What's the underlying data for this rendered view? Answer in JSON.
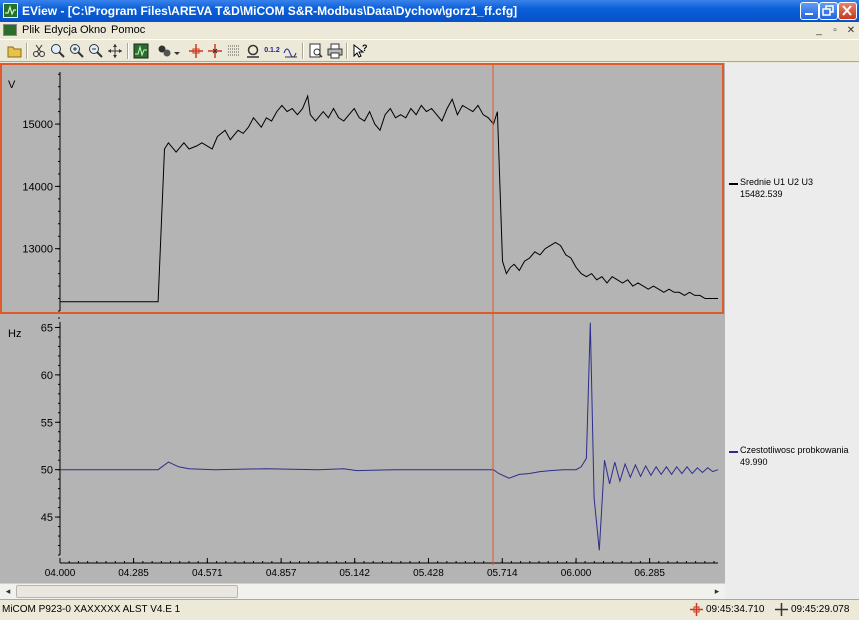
{
  "window": {
    "title": "EView - [C:\\Program Files\\AREVA T&D\\MiCOM S&R-Modbus\\Data\\Dychow\\gorz1_ff.cfg]"
  },
  "menu": [
    "Plik",
    "Edycja",
    "Okno",
    "Pomoc"
  ],
  "mdi_buttons": [
    "_",
    "▫",
    "✕"
  ],
  "toolbar_icons": [
    "open-folder-icon",
    "cut-icon",
    "zoom-icon",
    "zoom-in-icon",
    "zoom-out-icon",
    "zoom-fit-icon",
    "move-icon",
    "chart-icon",
    "color-icon",
    "dropdown-icon",
    "cursor1-icon",
    "cursor2-icon",
    "grid-icon",
    "omega-icon",
    "values-icon",
    "wave-icon",
    "print-preview-icon",
    "print-icon",
    "help-icon"
  ],
  "values_button_text": "0.1.2",
  "top_chart": {
    "unit_label": "V",
    "y_ticks": [
      "15000",
      "14000",
      "13000"
    ],
    "ylim": [
      12000,
      15900
    ],
    "legend": {
      "name": "Srednie U1 U2 U3",
      "value": "15482.539",
      "color": "#000000"
    },
    "frame_color": "#e05a2a"
  },
  "bottom_chart": {
    "unit_label": "Hz",
    "y_ticks": [
      "65",
      "60",
      "55",
      "50",
      "45"
    ],
    "ylim": [
      41,
      66
    ],
    "legend": {
      "name": "Czestotliwosc probkowania",
      "value": "49.990",
      "color": "#2d2d8c"
    }
  },
  "x_ticks": [
    "04.000",
    "04.285",
    "04.571",
    "04.857",
    "05.142",
    "05.428",
    "05.714",
    "06.000",
    "06.285"
  ],
  "cursor_color": "#e05a2a",
  "chart_data": [
    {
      "type": "line",
      "ylabel": "V",
      "x_range": [
        4.0,
        6.55
      ],
      "ylim": [
        12000,
        15900
      ],
      "series": [
        {
          "name": "Srednie U1 U2 U3",
          "color": "#000000",
          "x": [
            4.0,
            4.2,
            4.38,
            4.405,
            4.42,
            4.45,
            4.48,
            4.5,
            4.53,
            4.55,
            4.57,
            4.59,
            4.61,
            4.64,
            4.66,
            4.69,
            4.71,
            4.73,
            4.75,
            4.78,
            4.8,
            4.82,
            4.84,
            4.86,
            4.88,
            4.9,
            4.92,
            4.94,
            4.96,
            4.97,
            4.99,
            5.02,
            5.04,
            5.06,
            5.08,
            5.1,
            5.12,
            5.14,
            5.16,
            5.18,
            5.2,
            5.22,
            5.24,
            5.26,
            5.28,
            5.3,
            5.32,
            5.34,
            5.36,
            5.38,
            5.4,
            5.42,
            5.44,
            5.46,
            5.48,
            5.5,
            5.52,
            5.54,
            5.56,
            5.58,
            5.6,
            5.62,
            5.64,
            5.66,
            5.68,
            5.695,
            5.715,
            5.73,
            5.745,
            5.76,
            5.78,
            5.8,
            5.82,
            5.84,
            5.86,
            5.88,
            5.9,
            5.92,
            5.94,
            5.96,
            5.98,
            6.0,
            6.02,
            6.04,
            6.06,
            6.08,
            6.1,
            6.12,
            6.14,
            6.16,
            6.18,
            6.2,
            6.22,
            6.24,
            6.26,
            6.28,
            6.3,
            6.32,
            6.34,
            6.36,
            6.38,
            6.4,
            6.42,
            6.44,
            6.46,
            6.48,
            6.5,
            6.52,
            6.55
          ],
          "y": [
            12150,
            12150,
            12150,
            14600,
            14700,
            14550,
            14700,
            14600,
            14650,
            14700,
            14650,
            14600,
            14800,
            14900,
            14750,
            14900,
            14850,
            14950,
            15100,
            14950,
            15100,
            15050,
            15200,
            15300,
            15200,
            15250,
            15150,
            15250,
            15450,
            15150,
            15050,
            15200,
            15100,
            15250,
            15100,
            15050,
            15150,
            15250,
            15100,
            15050,
            15200,
            15000,
            14900,
            15150,
            15250,
            15100,
            15150,
            15100,
            15250,
            15150,
            15300,
            15200,
            15250,
            15150,
            15050,
            15250,
            15400,
            15150,
            15300,
            15250,
            15200,
            15300,
            15150,
            15100,
            15000,
            15200,
            12800,
            12600,
            12700,
            12750,
            12650,
            12800,
            12850,
            12950,
            12900,
            13000,
            13050,
            13100,
            13050,
            12900,
            12850,
            12700,
            12600,
            12550,
            12600,
            12500,
            12550,
            12450,
            12550,
            12500,
            12450,
            12500,
            12400,
            12450,
            12400,
            12350,
            12400,
            12350,
            12300,
            12350,
            12300,
            12300,
            12250,
            12300,
            12250,
            12250,
            12200,
            12200,
            12200
          ]
        }
      ]
    },
    {
      "type": "line",
      "ylabel": "Hz",
      "x_range": [
        4.0,
        6.55
      ],
      "ylim": [
        41,
        66
      ],
      "series": [
        {
          "name": "Czestotliwosc probkowania",
          "color": "#2d2d8c",
          "x": [
            4.0,
            4.2,
            4.38,
            4.42,
            4.46,
            4.5,
            4.6,
            4.8,
            5.0,
            5.1,
            5.15,
            5.3,
            5.5,
            5.68,
            5.7,
            5.74,
            5.78,
            5.82,
            5.86,
            5.9,
            5.95,
            6.0,
            6.02,
            6.04,
            6.055,
            6.07,
            6.09,
            6.11,
            6.13,
            6.15,
            6.17,
            6.19,
            6.21,
            6.23,
            6.25,
            6.27,
            6.29,
            6.31,
            6.33,
            6.35,
            6.37,
            6.39,
            6.41,
            6.43,
            6.45,
            6.47,
            6.49,
            6.51,
            6.53,
            6.55
          ],
          "y": [
            50,
            50,
            50,
            50.8,
            50.3,
            50.1,
            50.0,
            50.1,
            50.0,
            50.1,
            49.9,
            50.0,
            50.0,
            50.0,
            49.6,
            49.1,
            49.5,
            49.6,
            49.8,
            49.9,
            50.0,
            50.0,
            50.3,
            51.2,
            65.5,
            47.0,
            41.5,
            51.0,
            48.5,
            50.8,
            48.8,
            50.6,
            49.2,
            50.5,
            49.3,
            50.4,
            49.4,
            50.3,
            49.5,
            50.3,
            49.5,
            50.3,
            49.6,
            50.3,
            49.6,
            50.2,
            49.7,
            50.2,
            49.8,
            50.0
          ]
        }
      ]
    }
  ],
  "scrollbar": {
    "left_arrow": "◂",
    "right_arrow": "▸"
  },
  "status": {
    "device": "MiCOM P923-0 XAXXXXX ALST V4.E 1",
    "cursor1_time": "09:45:34.710",
    "cursor2_time": "09:45:29.078"
  }
}
